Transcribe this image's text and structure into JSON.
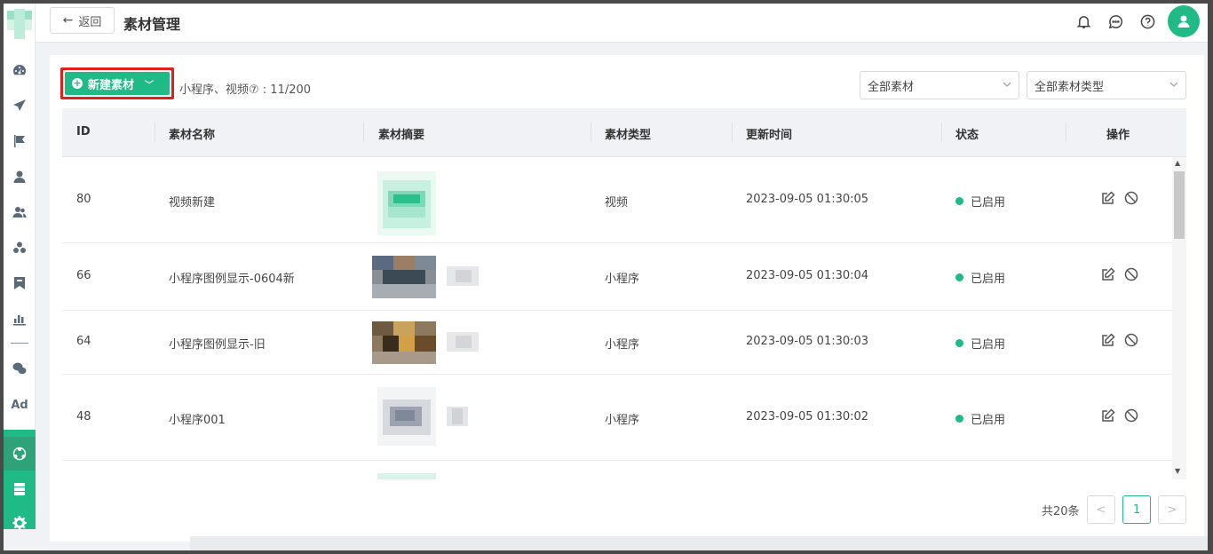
{
  "header": {
    "back_label": "返回",
    "title": "素材管理"
  },
  "sidebar": {
    "icons": [
      "dashboard-icon",
      "send-icon",
      "flag-icon",
      "user-icon",
      "users-icon",
      "group-icon",
      "bookmark-icon",
      "bar-chart-icon",
      "wechat-icon",
      "ad-icon"
    ],
    "ad_label": "Ad",
    "bottom_icons": [
      "share-circle-icon",
      "server-icon",
      "gear-icon"
    ]
  },
  "toolbar": {
    "new_button_label": "新建素材",
    "quota_text": "小程序、视频⑦ : 11/200",
    "filter_material": "全部素材",
    "filter_type": "全部素材类型"
  },
  "table": {
    "columns": [
      "ID",
      "素材名称",
      "素材摘要",
      "素材类型",
      "更新时间",
      "状态",
      "操作"
    ],
    "rows": [
      {
        "id": "80",
        "name": "视频新建",
        "type": "视频",
        "updated": "2023-09-05 01:30:05",
        "status": "已启用"
      },
      {
        "id": "66",
        "name": "小程序图例显示-0604新",
        "type": "小程序",
        "updated": "2023-09-05 01:30:04",
        "status": "已启用"
      },
      {
        "id": "64",
        "name": "小程序图例显示-旧",
        "type": "小程序",
        "updated": "2023-09-05 01:30:03",
        "status": "已启用"
      },
      {
        "id": "48",
        "name": "小程序001",
        "type": "小程序",
        "updated": "2023-09-05 01:30:02",
        "status": "已启用"
      }
    ]
  },
  "pagination": {
    "total_text": "共20条",
    "current_page": "1",
    "prev": "<",
    "next": ">"
  },
  "colors": {
    "accent": "#1fba86",
    "highlight_border": "#e0201a"
  }
}
